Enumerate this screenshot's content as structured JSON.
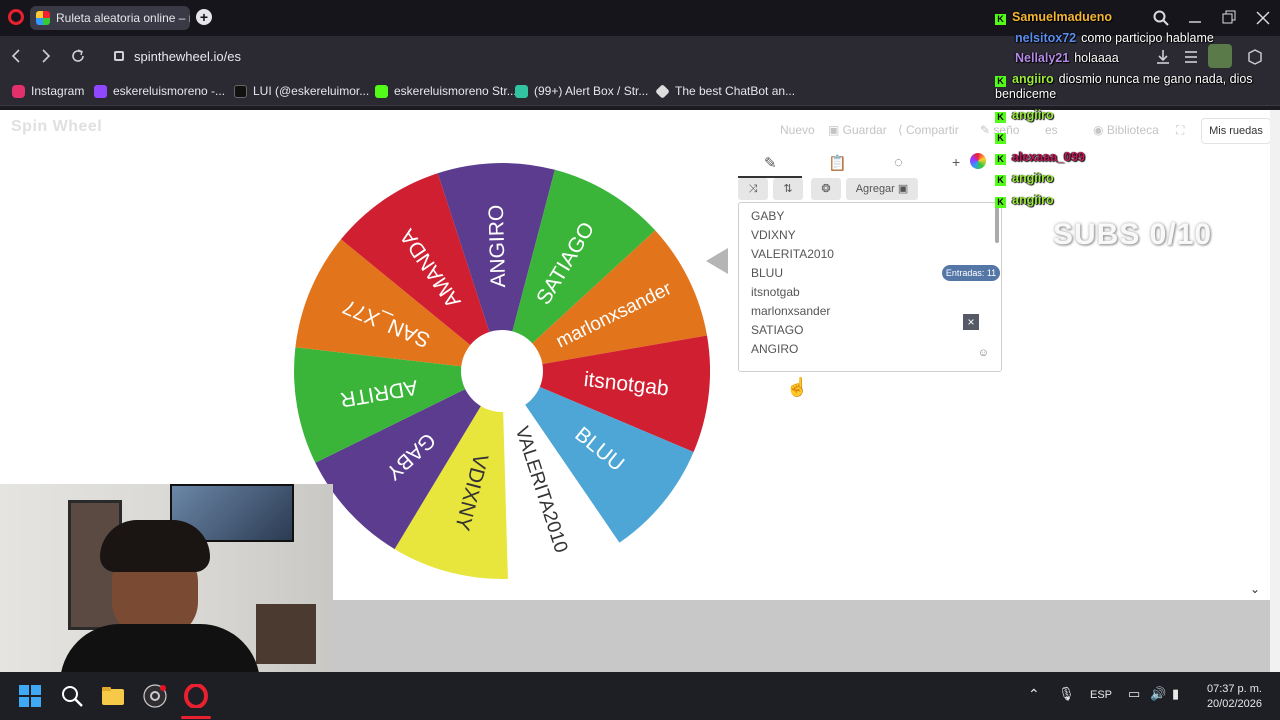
{
  "browser": {
    "tab_title": "Ruleta aleatoria online – n",
    "url": "spinthewheel.io/es"
  },
  "bookmarks": [
    {
      "label": "Instagram",
      "color": "#e1306c"
    },
    {
      "label": "eskereluismoreno -...",
      "color": "#9146ff"
    },
    {
      "label": "LUI (@eskereluimor...",
      "color": "#111111"
    },
    {
      "label": "eskereluismoreno Str...",
      "color": "#53fc18"
    },
    {
      "label": "(99+) Alert Box / Str...",
      "color": "#31c3a2"
    },
    {
      "label": "The best ChatBot an...",
      "color": "#dddddd"
    }
  ],
  "site": {
    "logo": "Spin Wheel",
    "menu": {
      "nuevo": "Nuevo",
      "guardar": "Guardar",
      "compartir": "Compartir",
      "diseno": "seño",
      "lang": "es",
      "biblioteca": "Biblioteca"
    },
    "mis_ruedas": "Mis ruedas"
  },
  "wheel": {
    "colors": {
      "purple": "#5c3c8f",
      "green": "#3ab53a",
      "orange": "#e2751b",
      "red": "#d11f32",
      "blue": "#4ea6d6",
      "white": "#ffffff",
      "yellow": "#e8e63d"
    },
    "segments": [
      {
        "label": "ANGIRO",
        "color": "#5c3c8f"
      },
      {
        "label": "SATIAGO",
        "color": "#3ab53a"
      },
      {
        "label": "marlonxsander",
        "color": "#e2751b"
      },
      {
        "label": "itsnotgab",
        "color": "#d11f32"
      },
      {
        "label": "BLUU",
        "color": "#4ea6d6"
      },
      {
        "label": "VALERITA2010",
        "color": "#ffffff"
      },
      {
        "label": "VDIXNY",
        "color": "#e8e63d"
      },
      {
        "label": "GABY",
        "color": "#5c3c8f"
      },
      {
        "label": "ADRITR",
        "color": "#3ab53a"
      },
      {
        "label": "SAN_X77",
        "color": "#e2751b"
      },
      {
        "label": "AMANDA",
        "color": "#d11f32"
      }
    ]
  },
  "editor": {
    "add_label": "Agregar",
    "entries": [
      "GABY",
      "VDIXNY",
      "VALERITA2010",
      "BLUU",
      "itsnotgab",
      "marlonxsander",
      "SATIAGO",
      "ANGIRO"
    ],
    "count_label": "Entradas: 11"
  },
  "chat": [
    {
      "user": "Samuelmadueno",
      "msg": "",
      "color": "#f5b733"
    },
    {
      "user": "nelsitox72",
      "msg": "como participo hablame",
      "color": "#5b8def"
    },
    {
      "user": "Nellaly21",
      "msg": "holaaaa",
      "color": "#b48ae6"
    },
    {
      "user": "angiiro",
      "msg": "diosmio nunca me gano nada, dios",
      "color": "#9bea3e"
    },
    {
      "user": "",
      "msg": "bendiceme",
      "color": "#ffffff"
    },
    {
      "user": "angiiro",
      "msg": "",
      "color": "#9bea3e"
    },
    {
      "user": "",
      "msg": "",
      "color": "#9bea3e"
    },
    {
      "user": "alexaaa_099",
      "msg": "",
      "color": "#c2185b"
    },
    {
      "user": "angiiro",
      "msg": "",
      "color": "#9bea3e"
    },
    {
      "user": "angiiro",
      "msg": "",
      "color": "#9bea3e"
    }
  ],
  "subs_goal": "SUBS 0/10",
  "taskbar": {
    "lang": "ESP",
    "time": "07:37 p. m.",
    "date": "20/02/2026"
  }
}
